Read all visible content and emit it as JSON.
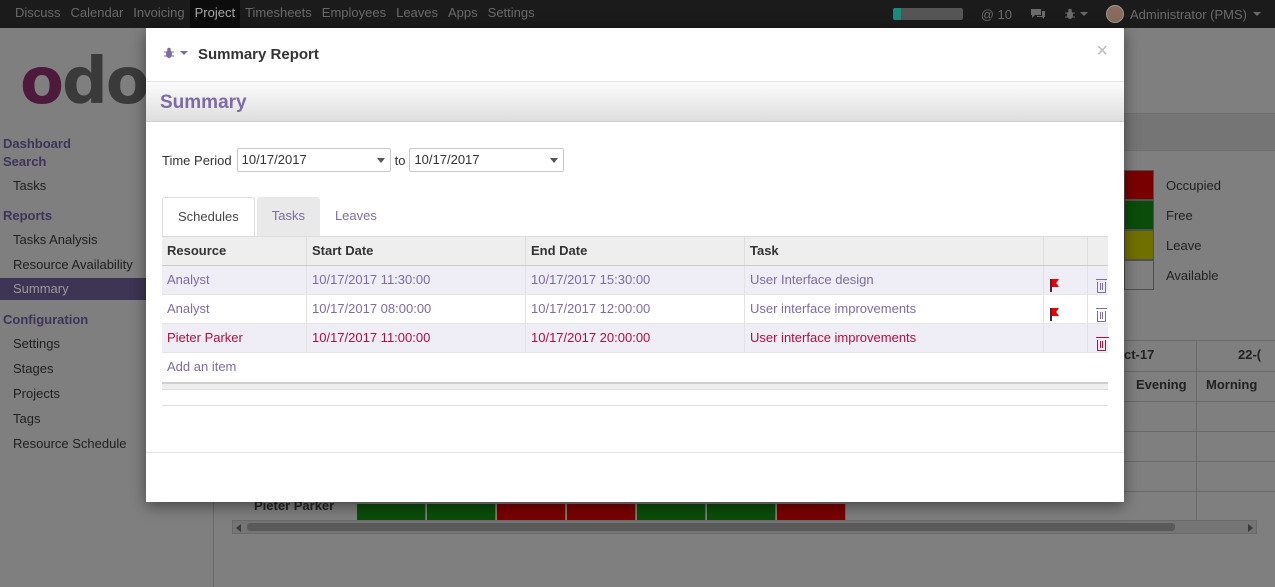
{
  "topnav": {
    "menu": [
      "Discuss",
      "Calendar",
      "Invoicing",
      "Project",
      "Timesheets",
      "Employees",
      "Leaves",
      "Apps",
      "Settings"
    ],
    "active": "Project",
    "messages": "@ 10",
    "user": "Administrator (PMS)",
    "progress_fraction": 0.12
  },
  "logo": {
    "first": "o",
    "rest": "do"
  },
  "sidebar": {
    "dashboard": "Dashboard",
    "search": "Search",
    "tasks": "Tasks",
    "reports": "Reports",
    "tasks_analysis": "Tasks Analysis",
    "resource_availability": "Resource Availability",
    "summary": "Summary",
    "configuration": "Configuration",
    "settings": "Settings",
    "stages": "Stages",
    "projects": "Projects",
    "tags": "Tags",
    "resource_schedule": "Resource Schedule"
  },
  "legend": [
    {
      "label": "Occupied",
      "color": "#7a0000"
    },
    {
      "label": "Free",
      "color": "#0a4d0a"
    },
    {
      "label": "Leave",
      "color": "#707000"
    },
    {
      "label": "Available",
      "color": "#7f7f7f"
    }
  ],
  "bg_grid": {
    "date1": "ct-17",
    "date2": "22-(",
    "evening": "Evening",
    "morning": "Morning",
    "bottom_name": "Pieter Parker"
  },
  "modal": {
    "title": "Summary Report",
    "close": "×",
    "sheet_title": "Summary",
    "period_label": "Time Period",
    "from_date": "10/17/2017",
    "to_label": "to",
    "to_date": "10/17/2017",
    "tabs": [
      "Schedules",
      "Tasks",
      "Leaves"
    ],
    "columns": [
      "Resource",
      "Start Date",
      "End Date",
      "Task"
    ],
    "rows": [
      {
        "resource": "Analyst",
        "start": "10/17/2017 11:30:00",
        "end": "10/17/2017 15:30:00",
        "task": "User Interface design",
        "flag": true,
        "style": "purple"
      },
      {
        "resource": "Analyst",
        "start": "10/17/2017 08:00:00",
        "end": "10/17/2017 12:00:00",
        "task": "User interface improvements",
        "flag": true,
        "style": "purple"
      },
      {
        "resource": "Pieter Parker",
        "start": "10/17/2017 11:00:00",
        "end": "10/17/2017 20:00:00",
        "task": "User interface improvements",
        "flag": false,
        "style": "red"
      }
    ],
    "add_item": "Add an item"
  }
}
